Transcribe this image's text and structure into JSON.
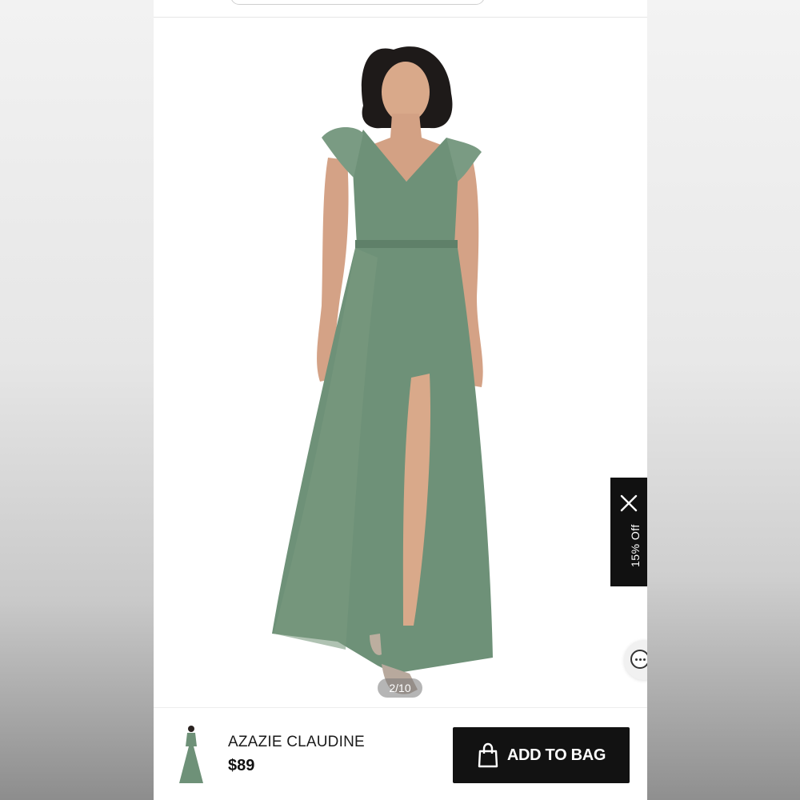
{
  "image_counter": "2/10",
  "promo": {
    "label": "15% Off",
    "close_icon": "close-icon"
  },
  "chat": {
    "icon": "chat-icon"
  },
  "product": {
    "name": "AZAZIE CLAUDINE",
    "price": "$89"
  },
  "cta": {
    "label": "ADD TO BAG",
    "icon": "shopping-bag-icon"
  },
  "colors": {
    "dress": "#6e9178",
    "button": "#121212",
    "promo_tab": "#111111"
  }
}
